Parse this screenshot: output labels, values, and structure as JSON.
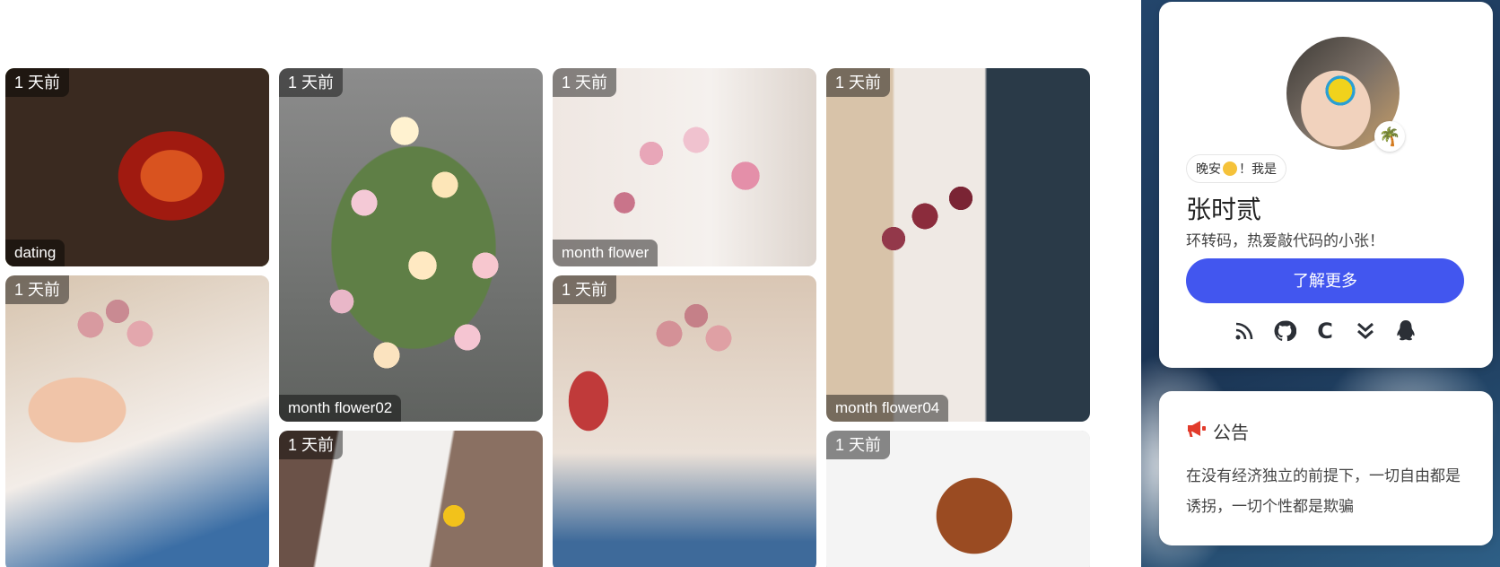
{
  "gallery": {
    "cards": [
      {
        "time": "1 天前",
        "caption": "dating"
      },
      {
        "time": "1 天前",
        "caption": "month flower02"
      },
      {
        "time": "1 天前",
        "caption": "month flower"
      },
      {
        "time": "1 天前",
        "caption": "month flower04"
      },
      {
        "time": "1 天前",
        "caption": ""
      },
      {
        "time": "1 天前",
        "caption": ""
      },
      {
        "time": "1 天前",
        "caption": ""
      },
      {
        "time": "1 天前",
        "caption": ""
      }
    ]
  },
  "profile": {
    "greeting_prefix": "晚安",
    "greeting_suffix": "！我是",
    "name": "张时贰",
    "description": "环转码，热爱敲代码的小张！",
    "more_label": "了解更多",
    "avatar_badge_icon": "palm-tree-icon",
    "socials": [
      {
        "icon": "rss-icon",
        "glyph": "◠"
      },
      {
        "icon": "github-icon",
        "glyph": "●"
      },
      {
        "icon": "csdn-icon",
        "glyph": "C"
      },
      {
        "icon": "double-chevron-down-icon",
        "glyph": "︾"
      },
      {
        "icon": "qq-penguin-icon",
        "glyph": "▲"
      }
    ]
  },
  "notice": {
    "title": "公告",
    "text": "在没有经济独立的前提下，一切自由都是诱拐，一切个性都是欺骗"
  },
  "colors": {
    "accent": "#4256ef",
    "notice_icon": "#e23b2b"
  }
}
